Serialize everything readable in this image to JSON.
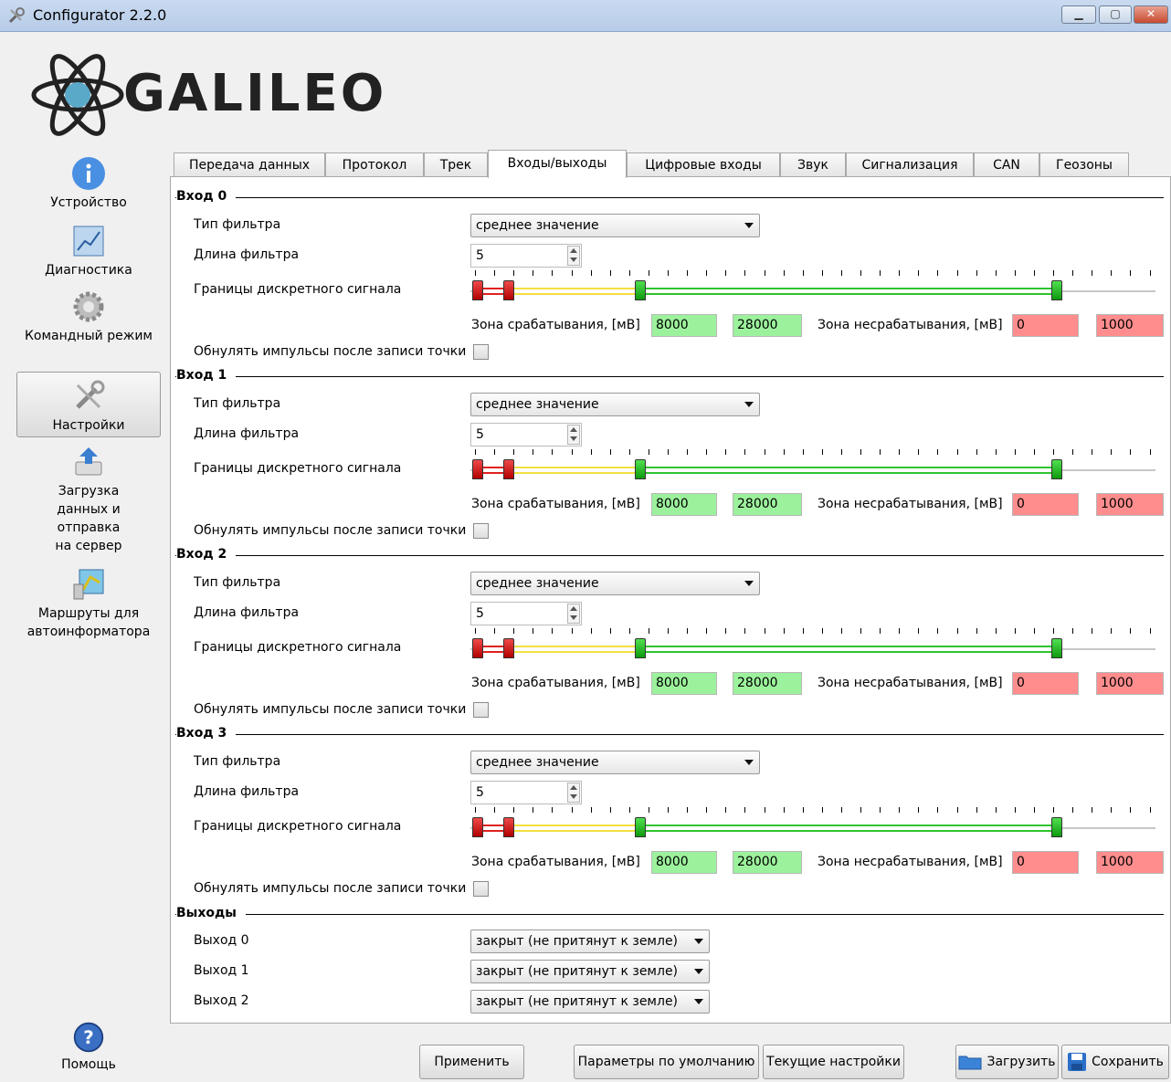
{
  "window": {
    "title": "Configurator 2.2.0"
  },
  "logo_text": "GALILEO",
  "sidebar": {
    "items": [
      {
        "label": "Устройство",
        "icon": "info-icon"
      },
      {
        "label": "Диагностика",
        "icon": "chart-icon"
      },
      {
        "label": "Командный режим",
        "icon": "gear-icon"
      },
      {
        "label": "Настройки",
        "icon": "tools-icon",
        "active": true
      },
      {
        "label": "Загрузка данных и отправка на сервер",
        "icon": "upload-icon"
      },
      {
        "label": "Маршруты для автоинформатора",
        "icon": "route-map-icon"
      }
    ],
    "help_label": "Помощь"
  },
  "tabs": [
    "Передача данных",
    "Протокол",
    "Трек",
    "Входы/выходы",
    "Цифровые входы",
    "Звук",
    "Сигнализация",
    "CAN",
    "Геозоны"
  ],
  "active_tab": "Входы/выходы",
  "inputs": [
    {
      "title": "Вход 0",
      "filter_type_label": "Тип фильтра",
      "filter_type": "среднее значение",
      "filter_length_label": "Длина фильтра",
      "filter_length": "5",
      "bounds_label": "Границы дискретного сигнала",
      "on_zone_label": "Зона срабатывания, [мВ]",
      "on_from": "8000",
      "on_to": "28000",
      "off_zone_label": "Зона несрабатывания, [мВ]",
      "off_from": "0",
      "off_to": "1000",
      "reset_label": "Обнулять импульсы после записи точки"
    },
    {
      "title": "Вход 1",
      "filter_type_label": "Тип фильтра",
      "filter_type": "среднее значение",
      "filter_length_label": "Длина фильтра",
      "filter_length": "5",
      "bounds_label": "Границы дискретного сигнала",
      "on_zone_label": "Зона срабатывания, [мВ]",
      "on_from": "8000",
      "on_to": "28000",
      "off_zone_label": "Зона несрабатывания, [мВ]",
      "off_from": "0",
      "off_to": "1000",
      "reset_label": "Обнулять импульсы после записи точки"
    },
    {
      "title": "Вход 2",
      "filter_type_label": "Тип фильтра",
      "filter_type": "среднее значение",
      "filter_length_label": "Длина фильтра",
      "filter_length": "5",
      "bounds_label": "Границы дискретного сигнала",
      "on_zone_label": "Зона срабатывания, [мВ]",
      "on_from": "8000",
      "on_to": "28000",
      "off_zone_label": "Зона несрабатывания, [мВ]",
      "off_from": "0",
      "off_to": "1000",
      "reset_label": "Обнулять импульсы после записи точки"
    },
    {
      "title": "Вход 3",
      "filter_type_label": "Тип фильтра",
      "filter_type": "среднее значение",
      "filter_length_label": "Длина фильтра",
      "filter_length": "5",
      "bounds_label": "Границы дискретного сигнала",
      "on_zone_label": "Зона срабатывания, [мВ]",
      "on_from": "8000",
      "on_to": "28000",
      "off_zone_label": "Зона несрабатывания, [мВ]",
      "off_from": "0",
      "off_to": "1000",
      "reset_label": "Обнулять импульсы после записи точки"
    }
  ],
  "outputs": {
    "title": "Выходы",
    "items": [
      {
        "label": "Выход 0",
        "value": "закрыт (не притянут к земле)"
      },
      {
        "label": "Выход 1",
        "value": "закрыт (не притянут к земле)"
      },
      {
        "label": "Выход 2",
        "value": "закрыт (не притянут к земле)"
      }
    ]
  },
  "buttons": {
    "apply": "Применить",
    "defaults": "Параметры по умолчанию",
    "current": "Текущие настройки",
    "load": "Загрузить",
    "save": "Сохранить"
  },
  "colors": {
    "on_zone": "#9cf29c",
    "off_zone": "#ff8d8d",
    "titlebar": "#c9daf0"
  }
}
